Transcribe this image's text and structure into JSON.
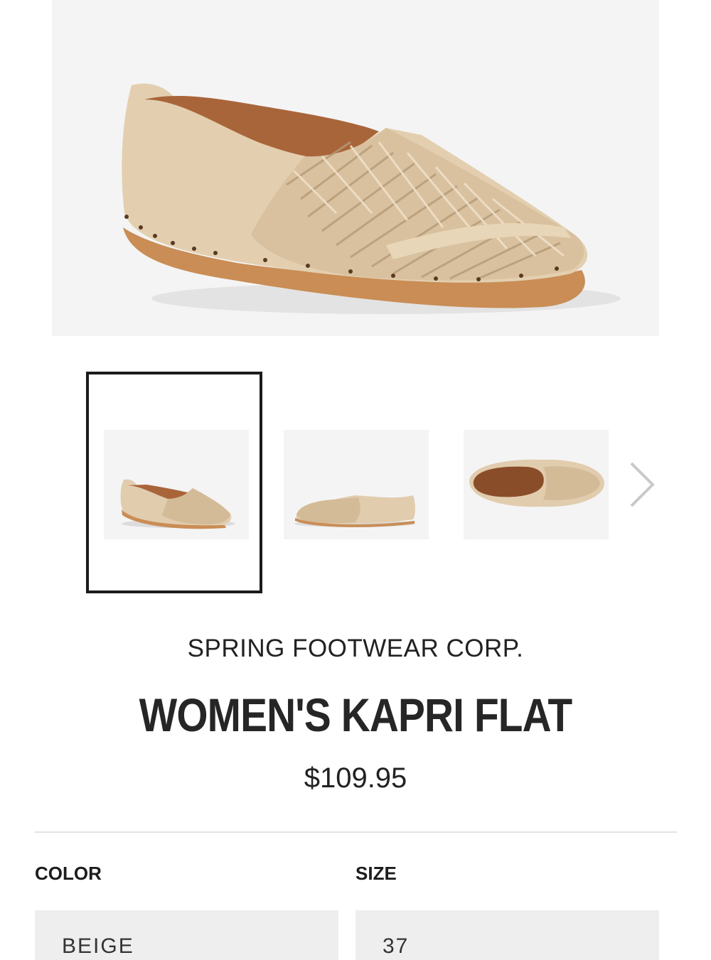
{
  "product": {
    "brand": "SPRING FOOTWEAR CORP.",
    "name": "WOMEN'S KAPRI FLAT",
    "price": "$109.95",
    "image_alt": "Women's Kapri Flat beige woven leather slip-on"
  },
  "gallery": {
    "thumbnails": [
      {
        "view": "three-quarter side",
        "selected": true
      },
      {
        "view": "side",
        "selected": false
      },
      {
        "view": "top",
        "selected": false
      }
    ],
    "next_icon": "chevron-right-icon"
  },
  "options": {
    "color_label": "COLOR",
    "size_label": "SIZE",
    "color_value": "BEIGE",
    "size_value": "37"
  },
  "colors": {
    "shoe_leather": "#e1ccae",
    "shoe_lining": "#a9653a",
    "sole": "#c98d55",
    "selected_border": "#1b1b1b",
    "panel_bg": "#f4f4f4"
  }
}
